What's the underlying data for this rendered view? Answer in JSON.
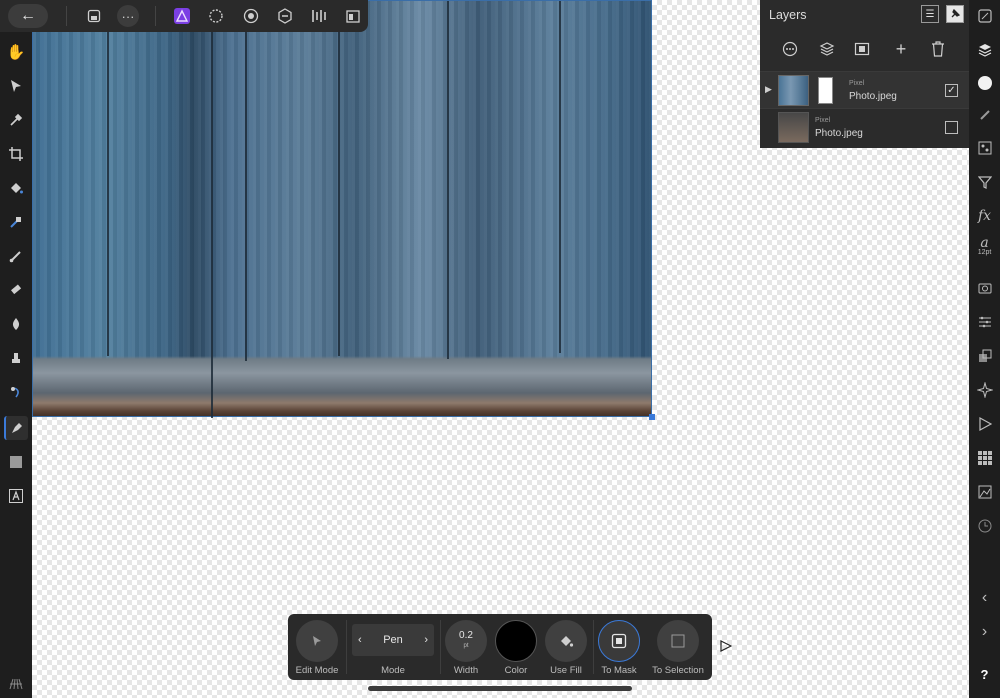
{
  "top_bar": {
    "back": "←",
    "doc_icon": "document-icon",
    "more": "···",
    "personas": [
      "affinity-photo-icon",
      "liquify-icon",
      "develop-icon",
      "tone-mapping-icon",
      "export-icon"
    ]
  },
  "layers_panel": {
    "title": "Layers",
    "actions": [
      "more-icon",
      "stack-icon",
      "mask-icon",
      "add-icon",
      "delete-icon"
    ],
    "layers": [
      {
        "type": "Pixel",
        "name": "Photo.jpeg",
        "checked": "✓"
      },
      {
        "type": "Pixel",
        "name": "Photo.jpeg",
        "checked": ""
      }
    ]
  },
  "right_bar": {
    "text_size": "12pt",
    "help": "?"
  },
  "context_toolbar": {
    "edit_mode": "Edit Mode",
    "mode_value": "Pen",
    "mode_label": "Mode",
    "width_value": "0.2",
    "width_unit": "pt",
    "width_label": "Width",
    "color_label": "Color",
    "use_fill_label": "Use Fill",
    "to_mask_label": "To Mask",
    "to_selection_label": "To Selection"
  },
  "colors": {
    "accent": "#3b7ad9",
    "panel": "#2b2b2b",
    "toolbar": "#1e1e1e",
    "stroke_color": "#000000"
  }
}
